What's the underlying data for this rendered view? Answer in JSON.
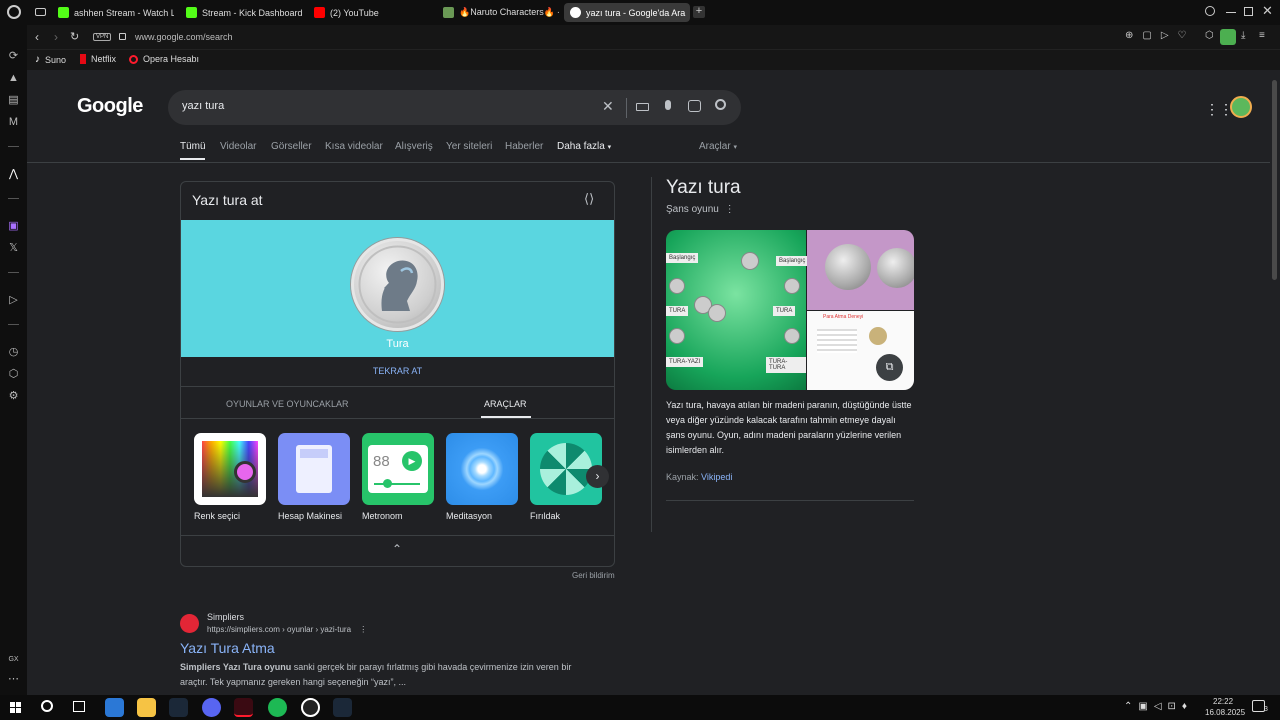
{
  "tabs": [
    {
      "label": "ashhen Stream - Watch L",
      "color": "#53fc18"
    },
    {
      "label": "Stream - Kick Dashboard",
      "color": "#53fc18"
    },
    {
      "label": "(2) YouTube",
      "color": "#ff0000"
    },
    {
      "label": "🔥Naruto Characters🔥 -",
      "color": "#6a9955"
    },
    {
      "label": "yazı tura - Google'da Ara",
      "color": "#ffffff"
    }
  ],
  "address": {
    "url": "www.google.com/search",
    "vpn": "VPN"
  },
  "bookmarks": [
    {
      "label": "Suno"
    },
    {
      "label": "Netflix"
    },
    {
      "label": "Opera Hesabı"
    }
  ],
  "google": {
    "logo": "Google",
    "query": "yazı tura",
    "nav_tabs": [
      "Tümü",
      "Videolar",
      "Görseller",
      "Kısa videolar",
      "Alışveriş",
      "Yer siteleri",
      "Haberler",
      "Daha fazla"
    ],
    "tools": "Araçlar"
  },
  "coin_card": {
    "title": "Yazı tura at",
    "coin_result": "Tura",
    "retry": "TEKRAR AT",
    "subtabs": [
      "OYUNLAR VE OYUNCAKLAR",
      "ARAÇLAR"
    ],
    "tools": [
      {
        "label": "Renk seçici"
      },
      {
        "label": "Hesap Makinesi"
      },
      {
        "label": "Metronom",
        "value": "88"
      },
      {
        "label": "Meditasyon"
      },
      {
        "label": "Fırıldak"
      }
    ],
    "feedback": "Geri bildirim"
  },
  "knowledge_panel": {
    "title": "Yazı tura",
    "subtitle": "Şans oyunu",
    "image_labels": [
      "Başlangıç",
      "Başlangıç",
      "TURA",
      "TURA",
      "TURA-YAZI",
      "TURA-TURA",
      "Para Atma Deneyi"
    ],
    "description": "Yazı tura, havaya atılan bir madeni paranın, düştüğünde üstte veya diğer yüzünde kalacak tarafını tahmin etmeye dayalı şans oyunu. Oyun, adını madeni paraların yüzlerine verilen isimlerden alır.",
    "source_label": "Kaynak:",
    "source_link": "Vikipedi"
  },
  "result": {
    "site": "Simpliers",
    "url": "https://simpliers.com › oyunlar › yazi-tura",
    "title": "Yazı Tura Atma",
    "snippet_bold": "Simpliers Yazı Tura oyunu",
    "snippet": " sanki gerçek bir parayı fırlatmış gibi havada çevirmenize izin veren bir araçtır. Tek yapmanız gereken hangi seçeneğin “yazı”, ..."
  },
  "taskbar": {
    "time": "22:22",
    "date": "16.08.2025",
    "notifications": "3"
  },
  "colors": {
    "accent_link": "#8ab4f8",
    "coin_bg": "#5ad6e0",
    "page_bg": "#202124"
  }
}
